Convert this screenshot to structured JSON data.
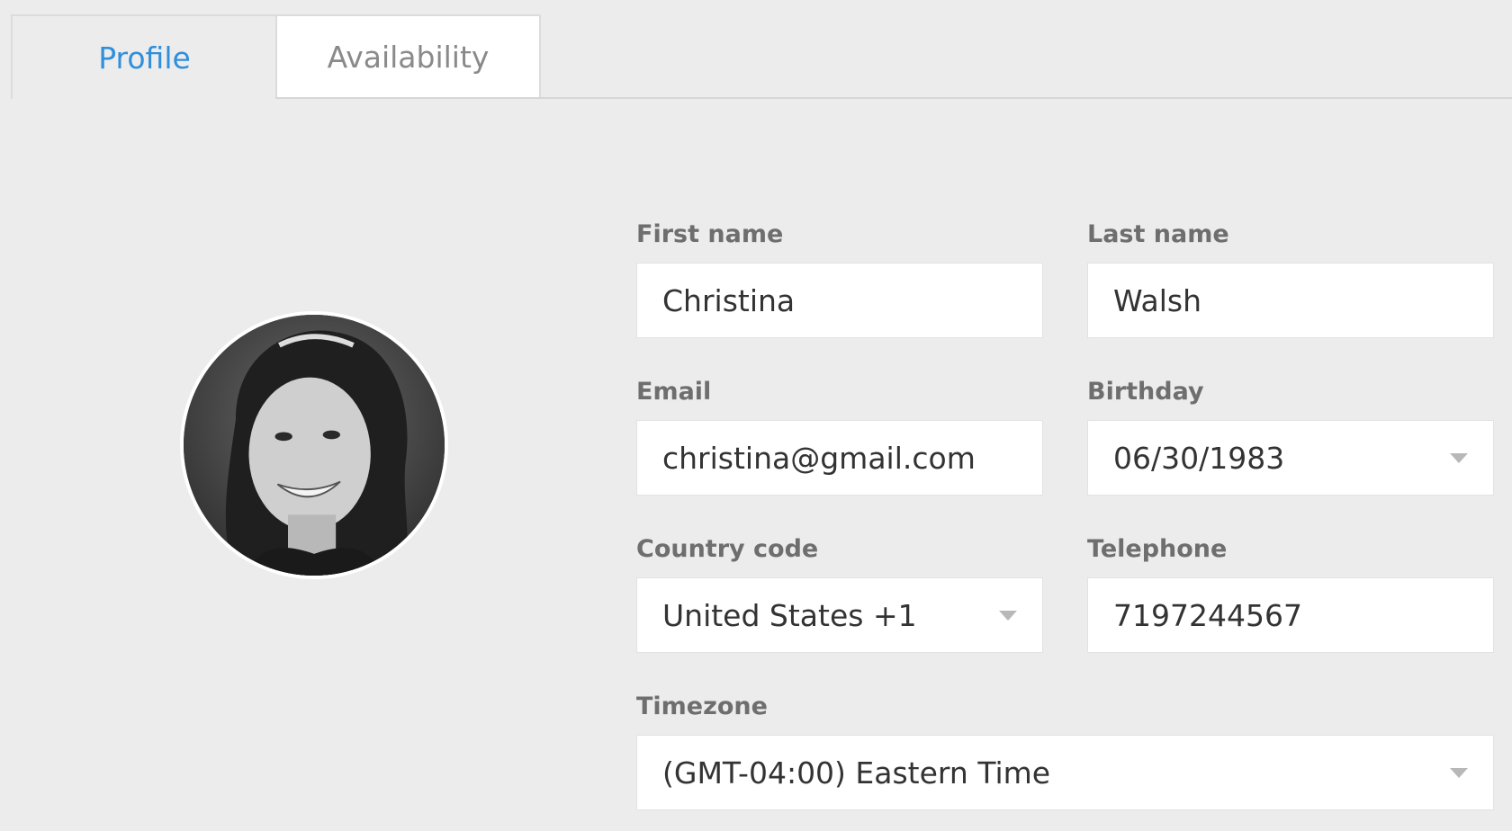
{
  "tabs": [
    {
      "label": "Profile",
      "active": true
    },
    {
      "label": "Availability",
      "active": false
    }
  ],
  "colors": {
    "accent": "#2f8fdc",
    "background": "#ececec",
    "label": "#6e6e6e",
    "field_bg": "#ffffff"
  },
  "avatar": {
    "icon": "profile-photo"
  },
  "form": {
    "first_name": {
      "label": "First name",
      "value": "Christina"
    },
    "last_name": {
      "label": "Last name",
      "value": "Walsh"
    },
    "email": {
      "label": "Email",
      "value": "christina@gmail.com"
    },
    "birthday": {
      "label": "Birthday",
      "value": "06/30/1983",
      "icon": "chevron-down-icon"
    },
    "country_code": {
      "label": "Country code",
      "value": "United States +1",
      "icon": "chevron-down-icon"
    },
    "telephone": {
      "label": "Telephone",
      "value": "7197244567"
    },
    "timezone": {
      "label": "Timezone",
      "value": "(GMT-04:00) Eastern Time",
      "icon": "chevron-down-icon"
    }
  }
}
